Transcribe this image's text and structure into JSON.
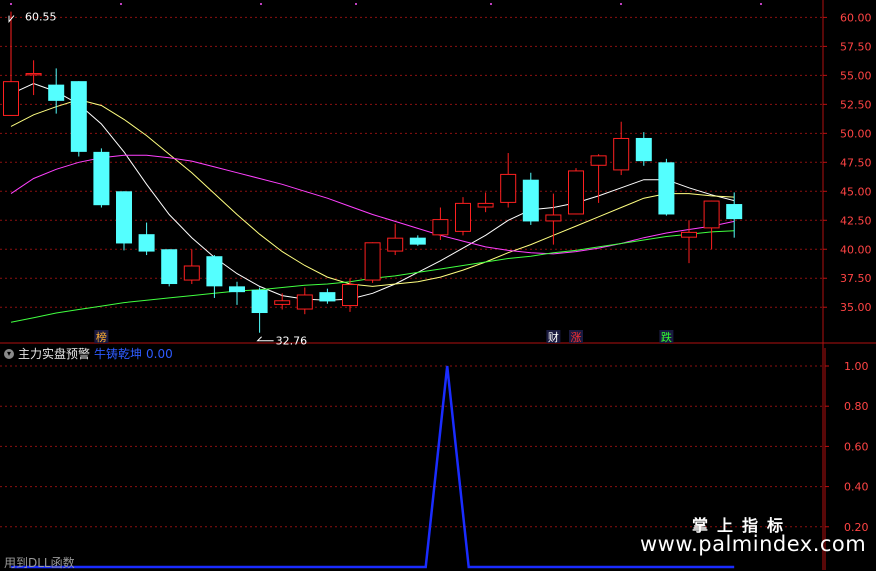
{
  "chart_data": {
    "type": "candlestick",
    "price_axis": {
      "ylim": [
        32.0,
        61.5
      ],
      "ticks": [
        "60.00",
        "57.50",
        "55.00",
        "52.50",
        "50.00",
        "47.50",
        "45.00",
        "42.50",
        "40.00",
        "37.50",
        "35.00"
      ]
    },
    "max_label": "60.55",
    "min_label": "32.76",
    "candles": [
      {
        "o": 51.5,
        "c": 54.5,
        "h": 60.5,
        "l": 51.5
      },
      {
        "o": 55.0,
        "c": 55.2,
        "h": 56.3,
        "l": 53.3
      },
      {
        "o": 54.2,
        "c": 52.8,
        "h": 55.6,
        "l": 51.7
      },
      {
        "o": 54.5,
        "c": 48.4,
        "h": 54.5,
        "l": 48.0
      },
      {
        "o": 48.4,
        "c": 43.8,
        "h": 48.7,
        "l": 43.6
      },
      {
        "o": 45.0,
        "c": 40.5,
        "h": 45.0,
        "l": 39.9
      },
      {
        "o": 41.3,
        "c": 39.8,
        "h": 42.3,
        "l": 39.5
      },
      {
        "o": 40.0,
        "c": 37.0,
        "h": 40.0,
        "l": 36.8
      },
      {
        "o": 37.3,
        "c": 38.6,
        "h": 40.0,
        "l": 37.0
      },
      {
        "o": 39.4,
        "c": 36.8,
        "h": 39.5,
        "l": 35.8
      },
      {
        "o": 36.8,
        "c": 36.3,
        "h": 37.2,
        "l": 35.2
      },
      {
        "o": 36.5,
        "c": 34.5,
        "h": 36.7,
        "l": 32.8
      },
      {
        "o": 35.2,
        "c": 35.6,
        "h": 36.2,
        "l": 34.8
      },
      {
        "o": 34.8,
        "c": 36.1,
        "h": 36.7,
        "l": 34.4
      },
      {
        "o": 36.3,
        "c": 35.5,
        "h": 36.6,
        "l": 35.3
      },
      {
        "o": 35.1,
        "c": 37.0,
        "h": 37.5,
        "l": 34.6
      },
      {
        "o": 37.3,
        "c": 40.6,
        "h": 40.6,
        "l": 37.1
      },
      {
        "o": 39.8,
        "c": 41.0,
        "h": 42.2,
        "l": 39.5
      },
      {
        "o": 41.0,
        "c": 40.4,
        "h": 41.2,
        "l": 40.3
      },
      {
        "o": 41.2,
        "c": 42.6,
        "h": 43.6,
        "l": 40.8
      },
      {
        "o": 41.5,
        "c": 44.0,
        "h": 44.5,
        "l": 41.2
      },
      {
        "o": 43.6,
        "c": 44.0,
        "h": 44.9,
        "l": 43.2
      },
      {
        "o": 44.0,
        "c": 46.5,
        "h": 48.3,
        "l": 43.6
      },
      {
        "o": 46.0,
        "c": 42.4,
        "h": 46.6,
        "l": 42.1
      },
      {
        "o": 42.4,
        "c": 43.0,
        "h": 44.8,
        "l": 40.4
      },
      {
        "o": 43.0,
        "c": 46.8,
        "h": 47.0,
        "l": 43.0
      },
      {
        "o": 47.2,
        "c": 48.1,
        "h": 48.2,
        "l": 44.0
      },
      {
        "o": 46.8,
        "c": 49.6,
        "h": 51.0,
        "l": 46.4
      },
      {
        "o": 49.6,
        "c": 47.6,
        "h": 50.1,
        "l": 47.2
      },
      {
        "o": 47.5,
        "c": 43.0,
        "h": 47.8,
        "l": 42.9
      },
      {
        "o": 41.0,
        "c": 41.5,
        "h": 42.5,
        "l": 38.8
      },
      {
        "o": 41.8,
        "c": 44.2,
        "h": 44.2,
        "l": 40.0
      },
      {
        "o": 43.9,
        "c": 42.6,
        "h": 44.9,
        "l": 41.0
      }
    ],
    "ma_series": [
      {
        "color": "#ffffff",
        "values": [
          53.4,
          54.3,
          53.6,
          52.5,
          50.8,
          48.4,
          45.6,
          43.0,
          41.0,
          39.3,
          37.9,
          36.8,
          36.0,
          35.7,
          35.6,
          35.7,
          36.2,
          37.0,
          38.0,
          39.0,
          40.1,
          41.2,
          42.5,
          43.4,
          43.6,
          44.0,
          44.6,
          45.3,
          46.0,
          46.0,
          45.3,
          44.7,
          44.2
        ]
      },
      {
        "color": "#ffff80",
        "values": [
          50.6,
          51.6,
          52.3,
          52.9,
          52.4,
          51.2,
          49.8,
          48.2,
          46.6,
          44.8,
          43.0,
          41.3,
          39.8,
          38.6,
          37.6,
          37.0,
          36.8,
          37.0,
          37.2,
          37.6,
          38.2,
          38.9,
          39.7,
          40.4,
          41.2,
          42.0,
          42.8,
          43.6,
          44.4,
          44.8,
          44.8,
          44.6,
          44.5
        ]
      },
      {
        "color": "#ff40ff",
        "values": [
          44.8,
          46.1,
          46.9,
          47.5,
          47.9,
          48.1,
          48.1,
          47.9,
          47.6,
          47.1,
          46.6,
          46.1,
          45.6,
          45.0,
          44.4,
          43.7,
          43.0,
          42.4,
          41.8,
          41.2,
          40.7,
          40.2,
          39.9,
          39.7,
          39.6,
          39.8,
          40.1,
          40.5,
          41.0,
          41.4,
          41.7,
          42.0,
          42.4
        ]
      },
      {
        "color": "#40ff40",
        "values": [
          33.7,
          34.1,
          34.5,
          34.8,
          35.1,
          35.4,
          35.6,
          35.8,
          36.0,
          36.2,
          36.4,
          36.5,
          36.7,
          36.9,
          37.0,
          37.2,
          37.5,
          37.7,
          38.0,
          38.3,
          38.6,
          38.9,
          39.2,
          39.4,
          39.7,
          39.9,
          40.2,
          40.5,
          40.8,
          41.1,
          41.3,
          41.5,
          41.6
        ]
      }
    ],
    "markers": [
      {
        "index": 4,
        "text": "榜",
        "color": "#ffb030"
      },
      {
        "index": 24,
        "text": "财",
        "color": "#ffffff"
      },
      {
        "index": 25,
        "text": "涨",
        "color": "#ff3030"
      },
      {
        "index": 29,
        "text": "跌",
        "color": "#30ff30"
      }
    ],
    "indicator": {
      "name": "主力实盘预警",
      "line_name": "牛铸乾坤",
      "value_text": "0.00",
      "ylim": [
        0.0,
        1.0
      ],
      "ticks": [
        "1.00",
        "0.80",
        "0.60",
        "0.40",
        "0.20"
      ],
      "values": [
        0,
        0,
        0,
        0,
        0,
        0,
        0,
        0,
        0,
        0,
        0,
        0,
        0,
        0,
        0,
        0,
        0,
        0,
        0,
        0,
        0,
        0,
        0,
        0,
        0,
        0,
        0,
        0,
        0,
        0,
        0,
        0,
        0
      ],
      "spike": {
        "x_index": 19.3,
        "value": 1.0,
        "half_width": 0.95
      }
    }
  },
  "footer_text": "用到DLL函数",
  "watermark": {
    "cn": "掌上指标",
    "url": "www.palmindex.com"
  },
  "colors": {
    "up": "#ff2020",
    "down": "#54ffff",
    "grid": "#8c1010",
    "axis_text": "#ff4444",
    "indicator_line": "#1a2cff",
    "purple_dots": "#c040c0"
  }
}
